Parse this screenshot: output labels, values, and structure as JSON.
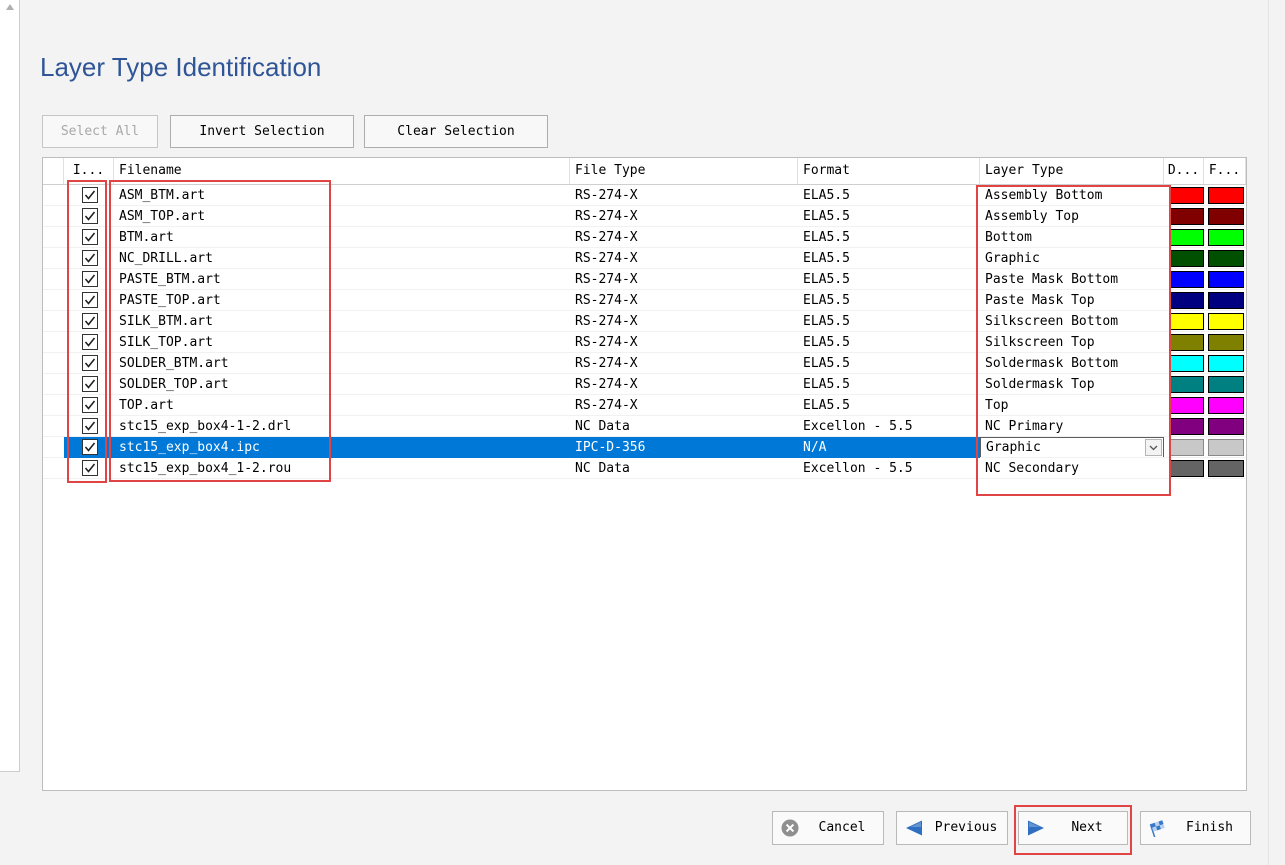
{
  "title": "Layer Type Identification",
  "colors": {
    "title": "#2f5597",
    "selection": "#0078d7",
    "highlight_box": "#e04444",
    "nav_arrow": "#2f6fc1"
  },
  "toolbar": {
    "select_all": "Select All",
    "select_all_enabled": false,
    "invert_selection": "Invert Selection",
    "clear_selection": "Clear Selection"
  },
  "table": {
    "headers": {
      "include": "I...",
      "filename": "Filename",
      "file_type": "File Type",
      "format": "Format",
      "layer_type": "Layer Type",
      "d_color": "D...",
      "f_color": "F..."
    },
    "selected_row": 12,
    "rows": [
      {
        "checked": true,
        "filename": "ASM_BTM.art",
        "file_type": "RS-274-X",
        "format": "ELA5.5",
        "layer_type": "Assembly Bottom",
        "d_color": "#ff0000",
        "f_color": "#ff0000"
      },
      {
        "checked": true,
        "filename": "ASM_TOP.art",
        "file_type": "RS-274-X",
        "format": "ELA5.5",
        "layer_type": "Assembly Top",
        "d_color": "#800000",
        "f_color": "#800000"
      },
      {
        "checked": true,
        "filename": "BTM.art",
        "file_type": "RS-274-X",
        "format": "ELA5.5",
        "layer_type": "Bottom",
        "d_color": "#00ff00",
        "f_color": "#00ff00"
      },
      {
        "checked": true,
        "filename": "NC_DRILL.art",
        "file_type": "RS-274-X",
        "format": "ELA5.5",
        "layer_type": "Graphic",
        "d_color": "#005000",
        "f_color": "#005000"
      },
      {
        "checked": true,
        "filename": "PASTE_BTM.art",
        "file_type": "RS-274-X",
        "format": "ELA5.5",
        "layer_type": "Paste Mask Bottom",
        "d_color": "#0000ff",
        "f_color": "#0000ff"
      },
      {
        "checked": true,
        "filename": "PASTE_TOP.art",
        "file_type": "RS-274-X",
        "format": "ELA5.5",
        "layer_type": "Paste Mask Top",
        "d_color": "#000080",
        "f_color": "#000080"
      },
      {
        "checked": true,
        "filename": "SILK_BTM.art",
        "file_type": "RS-274-X",
        "format": "ELA5.5",
        "layer_type": "Silkscreen Bottom",
        "d_color": "#ffff00",
        "f_color": "#ffff00"
      },
      {
        "checked": true,
        "filename": "SILK_TOP.art",
        "file_type": "RS-274-X",
        "format": "ELA5.5",
        "layer_type": "Silkscreen Top",
        "d_color": "#808000",
        "f_color": "#808000"
      },
      {
        "checked": true,
        "filename": "SOLDER_BTM.art",
        "file_type": "RS-274-X",
        "format": "ELA5.5",
        "layer_type": "Soldermask Bottom",
        "d_color": "#00ffff",
        "f_color": "#00ffff"
      },
      {
        "checked": true,
        "filename": "SOLDER_TOP.art",
        "file_type": "RS-274-X",
        "format": "ELA5.5",
        "layer_type": "Soldermask Top",
        "d_color": "#008080",
        "f_color": "#008080"
      },
      {
        "checked": true,
        "filename": "TOP.art",
        "file_type": "RS-274-X",
        "format": "ELA5.5",
        "layer_type": "Top",
        "d_color": "#ff00ff",
        "f_color": "#ff00ff"
      },
      {
        "checked": true,
        "filename": "stc15_exp_box4-1-2.drl",
        "file_type": "NC Data",
        "format": "Excellon - 5.5",
        "layer_type": "NC Primary",
        "d_color": "#800080",
        "f_color": "#800080"
      },
      {
        "checked": true,
        "filename": "stc15_exp_box4.ipc",
        "file_type": "IPC-D-356",
        "format": "N/A",
        "layer_type": "Graphic",
        "d_color": "#c8c8c8",
        "f_color": "#c8c8c8"
      },
      {
        "checked": true,
        "filename": "stc15_exp_box4_1-2.rou",
        "file_type": "NC Data",
        "format": "Excellon - 5.5",
        "layer_type": "NC Secondary",
        "d_color": "#646464",
        "f_color": "#646464"
      }
    ]
  },
  "footer": {
    "cancel": "Cancel",
    "previous": "Previous",
    "next": "Next",
    "finish": "Finish"
  },
  "icons": {
    "cancel": "cancel-icon",
    "previous": "arrow-left-icon",
    "next": "arrow-right-icon",
    "finish": "checkered-flag-icon",
    "checkbox": "checkmark-icon",
    "dropdown": "chevron-down-icon"
  }
}
